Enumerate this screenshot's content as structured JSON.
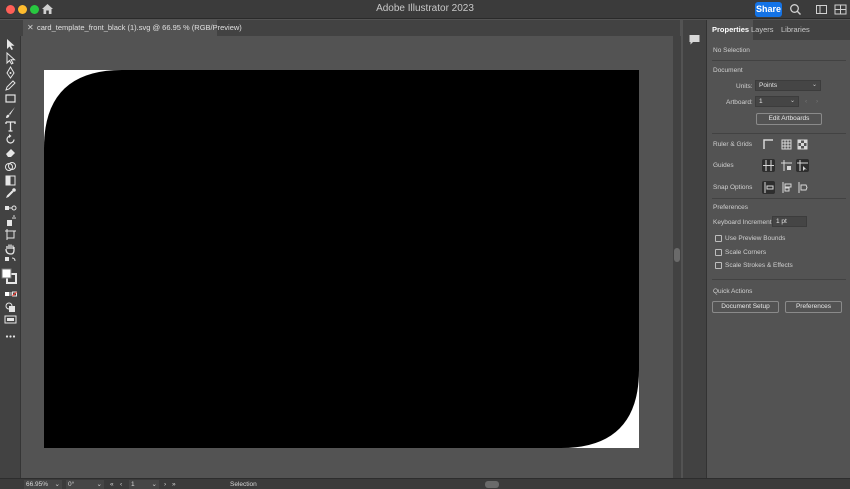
{
  "app": {
    "title": "Adobe Illustrator 2023",
    "share_label": "Share"
  },
  "colors": {
    "accent": "#1473e6",
    "close": "#ff5f57",
    "minimize": "#febc2e",
    "zoom": "#28c840",
    "artwork": "#000000",
    "artboard": "#ffffff"
  },
  "titlebar_icons": [
    "home-icon",
    "search-icon",
    "workspace-icon",
    "arrange-icon"
  ],
  "document": {
    "tab_title": "card_template_front_black (1).svg @ 66.95 % (RGB/Preview)"
  },
  "tools": [
    "selection-tool-icon",
    "direct-selection-tool-icon",
    "pen-tool-icon",
    "pencil-tool-icon",
    "rectangle-tool-icon",
    "paintbrush-tool-icon",
    "type-tool-icon",
    "rotate-tool-icon",
    "eraser-tool-icon",
    "shape-builder-tool-icon",
    "gradient-tool-icon",
    "eyedropper-tool-icon",
    "blend-tool-icon",
    "symbol-sprayer-tool-icon",
    "artboard-tool-icon",
    "hand-tool-icon",
    "swap-fill-stroke-icon",
    "fill-stroke-swatch-icon",
    "color-mode-icon",
    "draw-mode-icon",
    "screen-mode-icon",
    "more-tools-icon"
  ],
  "panel": {
    "tabs": [
      "Properties",
      "Layers",
      "Libraries"
    ],
    "no_selection": "No Selection",
    "document_heading": "Document",
    "units_label": "Units:",
    "units_value": "Points",
    "artboard_label": "Artboard:",
    "artboard_value": "1",
    "edit_artboards": "Edit Artboards",
    "ruler_grids": "Ruler & Grids",
    "guides": "Guides",
    "snap_options": "Snap Options",
    "preferences_heading": "Preferences",
    "keyboard_increment_label": "Keyboard Increment:",
    "keyboard_increment_value": "1 pt",
    "use_preview_bounds": "Use Preview Bounds",
    "scale_corners": "Scale Corners",
    "scale_strokes": "Scale Strokes & Effects",
    "quick_actions": "Quick Actions",
    "document_setup": "Document Setup",
    "preferences_btn": "Preferences"
  },
  "status": {
    "zoom": "66.95%",
    "rotation": "0°",
    "artboard": "1",
    "tool": "Selection"
  }
}
